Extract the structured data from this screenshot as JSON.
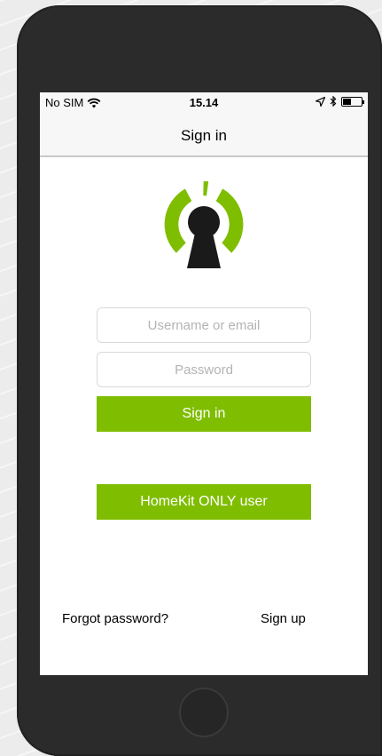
{
  "status_bar": {
    "carrier": "No SIM",
    "time": "15.14",
    "icons": [
      "wifi-icon",
      "location-icon",
      "bluetooth-icon",
      "battery-icon"
    ]
  },
  "nav": {
    "title": "Sign in"
  },
  "logo": {
    "icon": "keyhole-logo-icon",
    "colors": {
      "accent": "#7fbd00",
      "keyhole": "#1a1a1a"
    }
  },
  "form": {
    "username_placeholder": "Username or email",
    "password_placeholder": "Password",
    "signin_label": "Sign in",
    "homekit_label": "HomeKit ONLY user"
  },
  "links": {
    "forgot": "Forgot password?",
    "signup": "Sign up"
  },
  "colors": {
    "button": "#7fbd00",
    "phone_frame": "#2b2b2b"
  }
}
